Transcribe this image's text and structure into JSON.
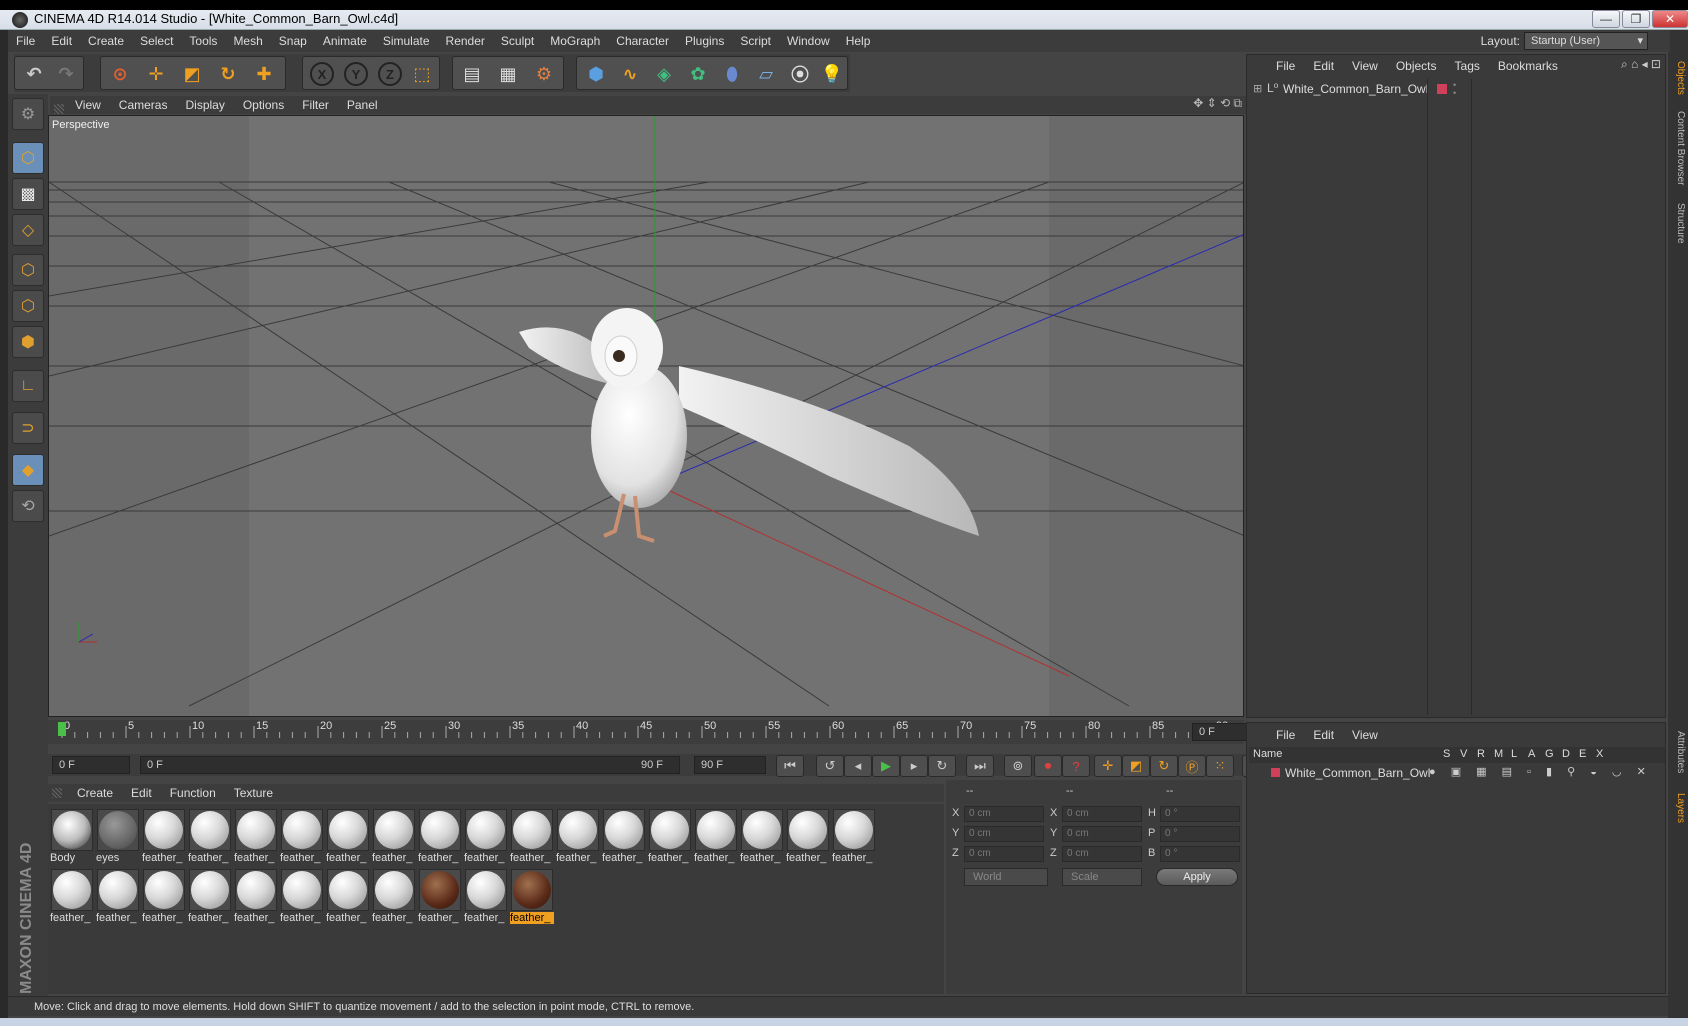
{
  "window": {
    "title": "CINEMA 4D R14.014 Studio - [White_Common_Barn_Owl.c4d]",
    "minimize_label": "—",
    "maximize_label": "❐",
    "close_label": "✕"
  },
  "menubar": {
    "items": [
      "File",
      "Edit",
      "Create",
      "Select",
      "Tools",
      "Mesh",
      "Snap",
      "Animate",
      "Simulate",
      "Render",
      "Sculpt",
      "MoGraph",
      "Character",
      "Plugins",
      "Script",
      "Window",
      "Help"
    ],
    "layout_label": "Layout:",
    "layout_value": "Startup (User)"
  },
  "toolbar": {
    "icons": [
      "undo-icon",
      "redo-icon",
      "live-selection-icon",
      "move-icon",
      "scale-icon",
      "rotate-icon",
      "last-tool-icon",
      "x-axis-icon",
      "y-axis-icon",
      "z-axis-icon",
      "world-coordinates-icon",
      "render-view-icon",
      "render-picture-viewer-icon",
      "render-settings-icon",
      "cube-icon",
      "spline-pen-icon",
      "subdivision-surface-icon",
      "cloner-icon",
      "deformer-icon",
      "floor-icon",
      "camera-icon",
      "light-icon"
    ],
    "axis_labels": [
      "X",
      "Y",
      "Z"
    ]
  },
  "viewport": {
    "menu": [
      "View",
      "Cameras",
      "Display",
      "Options",
      "Filter",
      "Panel"
    ],
    "label": "Perspective",
    "colors": {
      "background": "#6a6a6a",
      "grid": "#3a3a3a",
      "x_axis": "#b03030",
      "y_axis": "#20a020",
      "z_axis": "#2a2ab0"
    }
  },
  "timeline": {
    "ticks": [
      "0",
      "5",
      "10",
      "15",
      "20",
      "25",
      "30",
      "35",
      "40",
      "45",
      "50",
      "55",
      "60",
      "65",
      "70",
      "75",
      "80",
      "85",
      "90"
    ],
    "current_frame": "0 F",
    "start_field": "0 F",
    "range_start": "0 F",
    "range_end": "90 F",
    "end_field": "90 F"
  },
  "materials": {
    "menu": [
      "Create",
      "Edit",
      "Function",
      "Texture"
    ],
    "row1": [
      "Body",
      "eyes",
      "feather_",
      "feather_",
      "feather_",
      "feather_",
      "feather_",
      "feather_",
      "feather_",
      "feather_",
      "feather_",
      "feather_",
      "feather_",
      "feather_",
      "feather_",
      "feather_",
      "feather_",
      "feather_"
    ],
    "row2": [
      "feather_",
      "feather_",
      "feather_",
      "feather_",
      "feather_",
      "feather_",
      "feather_",
      "feather_",
      "feather_",
      "feather_",
      "feather_"
    ],
    "selected_label": "feather_"
  },
  "coordinates": {
    "header": [
      "--",
      "--",
      "--"
    ],
    "rows": [
      {
        "a": "X",
        "av": "0 cm",
        "b": "X",
        "bv": "0 cm",
        "c": "H",
        "cv": "0 °"
      },
      {
        "a": "Y",
        "av": "0 cm",
        "b": "Y",
        "bv": "0 cm",
        "c": "P",
        "cv": "0 °"
      },
      {
        "a": "Z",
        "av": "0 cm",
        "b": "Z",
        "bv": "0 cm",
        "c": "B",
        "cv": "0 °"
      }
    ],
    "mode": "World",
    "type": "Scale",
    "apply": "Apply"
  },
  "objects": {
    "menu": [
      "File",
      "Edit",
      "View",
      "Objects",
      "Tags",
      "Bookmarks"
    ],
    "items": [
      {
        "name": "White_Common_Barn_Owl",
        "color": "#d0405a"
      }
    ]
  },
  "layers": {
    "menu": [
      "File",
      "Edit",
      "View"
    ],
    "name_header": "Name",
    "columns": [
      "S",
      "V",
      "R",
      "M",
      "L",
      "A",
      "G",
      "D",
      "E",
      "X"
    ],
    "items": [
      {
        "name": "White_Common_Barn_Owl"
      }
    ]
  },
  "side_tabs": {
    "top": [
      "Objects",
      "Content Browser",
      "Structure"
    ],
    "bottom": [
      "Attributes",
      "Layers"
    ]
  },
  "brand": {
    "text": "MAXON CINEMA 4D"
  },
  "status": {
    "text": "Move: Click and drag to move elements. Hold down SHIFT to quantize movement / add to the selection in point mode, CTRL to remove."
  }
}
